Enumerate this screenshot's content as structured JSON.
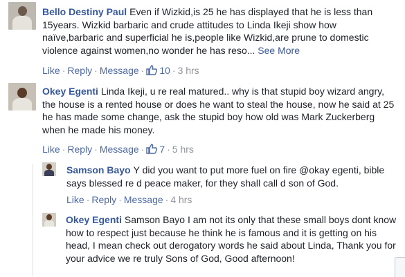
{
  "comments": [
    {
      "author": "Bello Destiny Paul",
      "text": "Even if Wizkid,is 25 he has displayed that he is less than 15years. Wizkid barbaric and crude attitudes to Linda Ikeji show how naïve,barbaric and superficial he is,people like Wizkid,are prune to domestic violence against women,no wonder he has reso...",
      "see_more": "See More",
      "like_label": "Like",
      "reply_label": "Reply",
      "message_label": "Message",
      "likes": "10",
      "time": "3 hrs"
    },
    {
      "author": "Okey Egenti",
      "text": "Linda Ikeji, u re real matured.. why is that stupid boy wizard angry, the house is a rented house or does he want to steal the house, now he said at 25 he has made some change, ask the stupid boy how old was Mark Zuckerberg when he made his money.",
      "like_label": "Like",
      "reply_label": "Reply",
      "message_label": "Message",
      "likes": "7",
      "time": "5 hrs"
    }
  ],
  "replies": [
    {
      "author": "Samson Bayo",
      "text": "Y did you want to put more fuel on fire @okay egenti, bible says blessed re d peace maker, for they shall call d son of God.",
      "like_label": "Like",
      "reply_label": "Reply",
      "message_label": "Message",
      "time": "4 hrs"
    },
    {
      "author": "Okey Egenti",
      "text": "Samson Bayo I am not its only that these small boys dont know how to respect just because he think he is famous and it is getting on his head, I mean check out derogatory words he said about Linda, Thank you for your advice we re truly Sons of God, Good afternoon!"
    }
  ],
  "colors": {
    "link": "#365899",
    "action": "#4b68a5",
    "meta": "#90949c",
    "text": "#1d2129"
  }
}
